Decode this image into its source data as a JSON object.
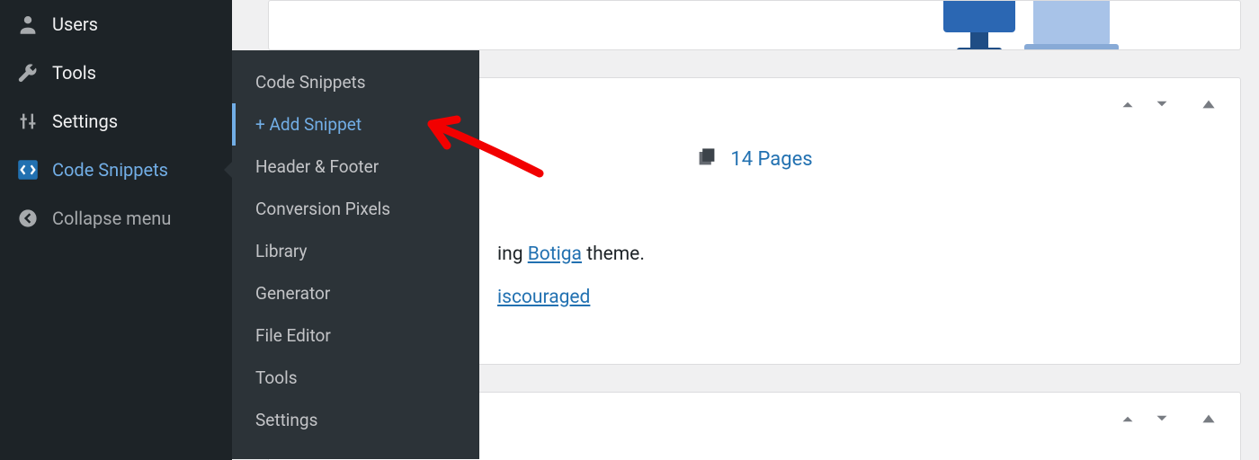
{
  "sidebar": {
    "users": "Users",
    "tools": "Tools",
    "settings": "Settings",
    "code_snippets": "Code Snippets",
    "collapse": "Collapse menu"
  },
  "flyout": [
    "Code Snippets",
    "+ Add Snippet",
    "Header & Footer",
    "Conversion Pixels",
    "Library",
    "Generator",
    "File Editor",
    "Tools",
    "Settings"
  ],
  "main": {
    "pages_count": "14 Pages",
    "theme_prefix": "ing ",
    "theme_link": "Botiga",
    "theme_suffix": " theme.",
    "discouraged_link": "iscouraged"
  }
}
